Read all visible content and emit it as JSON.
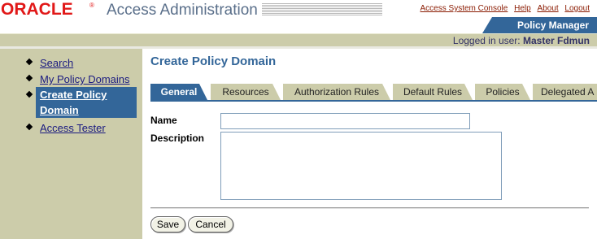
{
  "header": {
    "logo_text": "ORACLE",
    "logo_reg": "®",
    "app_title": "Access Administration",
    "links": [
      "Access System Console",
      "Help",
      "About",
      "Logout"
    ],
    "section_tab": "Policy Manager",
    "logged_in_prefix": "Logged in user:",
    "logged_in_user": "Master Fdmun"
  },
  "sidebar": {
    "items": [
      {
        "label": "Search"
      },
      {
        "label": "My Policy Domains"
      },
      {
        "label_line1": "Create Policy",
        "label_line2": "Domain",
        "selected": true
      },
      {
        "label": "Access Tester"
      }
    ]
  },
  "main": {
    "title": "Create Policy Domain",
    "tabs": [
      {
        "label": "General",
        "active": true
      },
      {
        "label": "Resources"
      },
      {
        "label": "Authorization Rules"
      },
      {
        "label": "Default Rules"
      },
      {
        "label": "Policies"
      },
      {
        "label": "Delegated A"
      }
    ],
    "form": {
      "name_label": "Name",
      "name_value": "",
      "description_label": "Description",
      "description_value": ""
    },
    "buttons": {
      "save": "Save",
      "cancel": "Cancel"
    }
  },
  "colors": {
    "brand_red": "#e11818",
    "accent_blue": "#336699",
    "tan": "#ccccaa"
  }
}
